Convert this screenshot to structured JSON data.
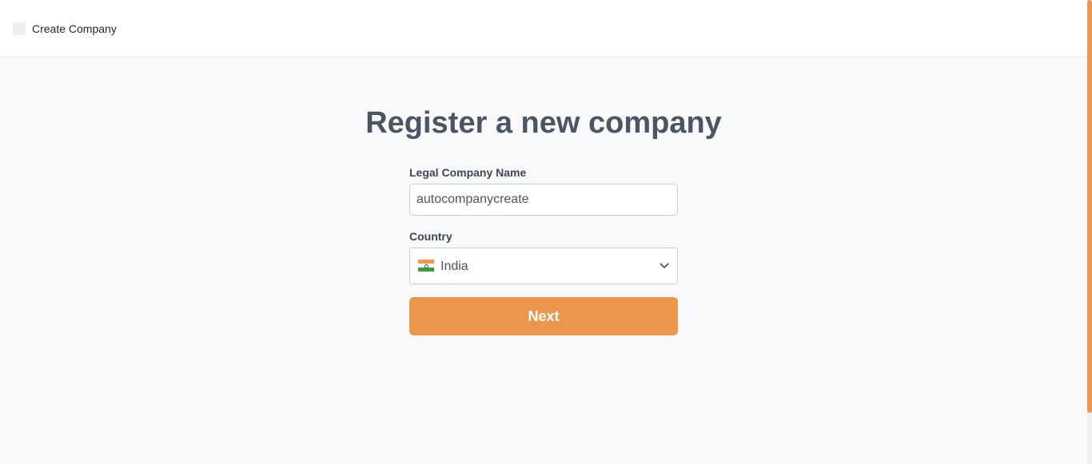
{
  "header": {
    "title": "Create Company",
    "logo_icon": "app-logo-icon"
  },
  "main": {
    "heading": "Register a new company",
    "company_name": {
      "label": "Legal Company Name",
      "value": "autocompanycreate"
    },
    "country": {
      "label": "Country",
      "selected": "India",
      "flag_icon": "india-flag-icon",
      "dropdown_icon": "chevron-down-icon"
    },
    "next_label": "Next"
  },
  "colors": {
    "accent": "#ec964d",
    "heading": "#4b5563",
    "background": "#f8f9fb"
  }
}
